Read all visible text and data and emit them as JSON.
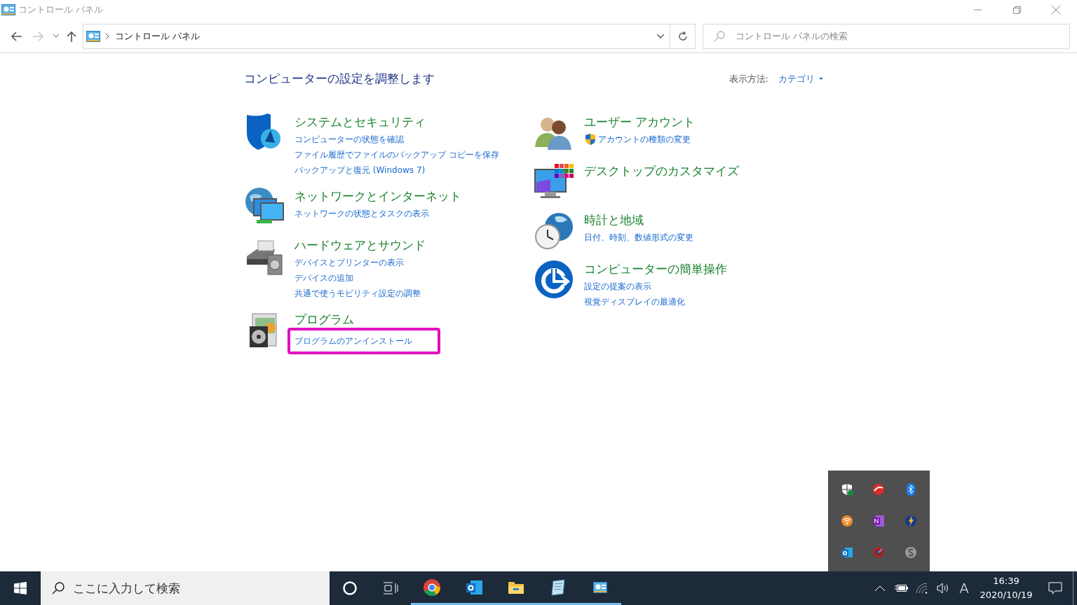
{
  "window": {
    "title": "コントロール パネル"
  },
  "address": {
    "path": "コントロール パネル"
  },
  "search": {
    "placeholder": "コントロール パネルの検索"
  },
  "heading": "コンピューターの設定を調整します",
  "view_by": {
    "label": "表示方法:",
    "value": "カテゴリ"
  },
  "columns": [
    [
      {
        "kind": "security",
        "title": "システムとセキュリティ",
        "links": [
          {
            "text": "コンピューターの状態を確認",
            "shield": false,
            "highlighted": false
          },
          {
            "text": "ファイル履歴でファイルのバックアップ コピーを保存",
            "shield": false,
            "highlighted": false
          },
          {
            "text": "バックアップと復元 (Windows 7)",
            "shield": false,
            "highlighted": false
          }
        ]
      },
      {
        "kind": "network",
        "title": "ネットワークとインターネット",
        "links": [
          {
            "text": "ネットワークの状態とタスクの表示",
            "shield": false,
            "highlighted": false
          }
        ]
      },
      {
        "kind": "hardware",
        "title": "ハードウェアとサウンド",
        "links": [
          {
            "text": "デバイスとプリンターの表示",
            "shield": false,
            "highlighted": false
          },
          {
            "text": "デバイスの追加",
            "shield": false,
            "highlighted": false
          },
          {
            "text": "共通で使うモビリティ設定の調整",
            "shield": false,
            "highlighted": false
          }
        ]
      },
      {
        "kind": "programs",
        "title": "プログラム",
        "links": [
          {
            "text": "プログラムのアンインストール",
            "shield": false,
            "highlighted": true
          }
        ]
      }
    ],
    [
      {
        "kind": "users",
        "title": "ユーザー アカウント",
        "links": [
          {
            "text": "アカウントの種類の変更",
            "shield": true,
            "highlighted": false
          }
        ]
      },
      {
        "kind": "desktop",
        "title": "デスクトップのカスタマイズ"
      },
      {
        "kind": "clock",
        "title": "時計と地域",
        "links": [
          {
            "text": "日付、時刻、数値形式の変更",
            "shield": false,
            "highlighted": false
          }
        ]
      },
      {
        "kind": "access",
        "title": "コンピューターの簡単操作",
        "links": [
          {
            "text": "設定の提案の表示",
            "shield": false,
            "highlighted": false
          },
          {
            "text": "視覚ディスプレイの最適化",
            "shield": false,
            "highlighted": false
          }
        ]
      }
    ]
  ],
  "taskbar": {
    "search_placeholder": "ここに入力して検索",
    "apps": [
      {
        "kind": "chrome",
        "running": true
      },
      {
        "kind": "outlook",
        "running": true
      },
      {
        "kind": "explorer",
        "running": true
      },
      {
        "kind": "notepad",
        "running": true
      },
      {
        "kind": "control",
        "running": true
      }
    ],
    "ime": "A",
    "time": "16:39",
    "date": "2020/10/19"
  }
}
